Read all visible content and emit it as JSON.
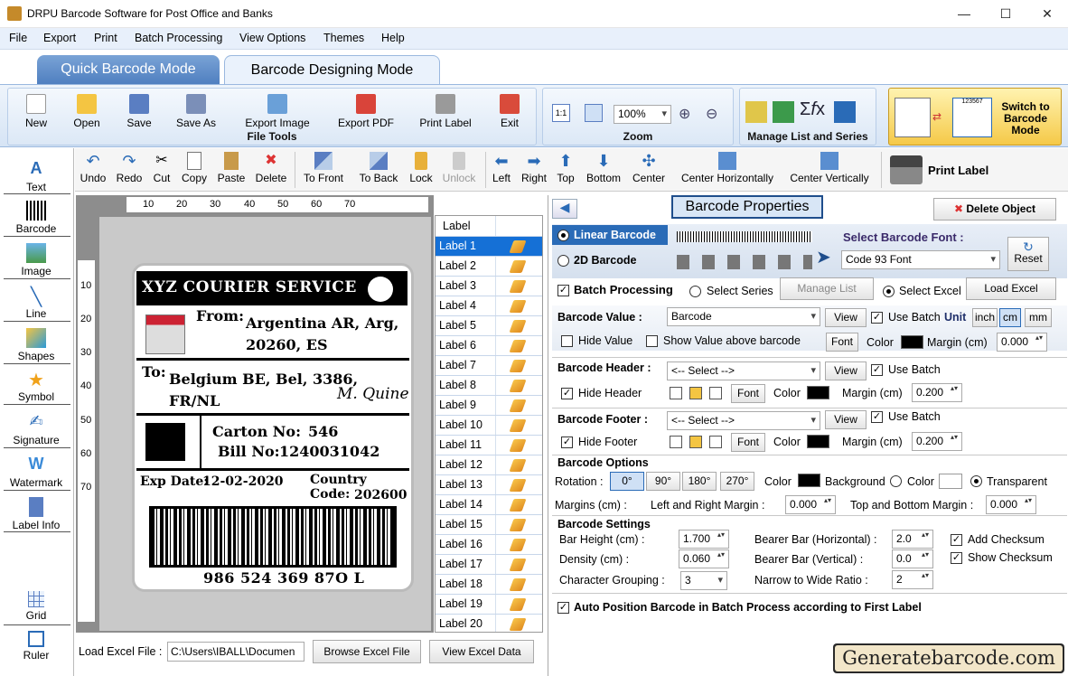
{
  "window": {
    "title": "DRPU Barcode Software for Post Office and Banks",
    "minimize": "—",
    "maximize": "☐",
    "close": "✕"
  },
  "menu": [
    "File",
    "Export",
    "Print",
    "Batch Processing",
    "View Options",
    "Themes",
    "Help"
  ],
  "mode_tabs": {
    "quick": "Quick Barcode Mode",
    "design": "Barcode Designing Mode"
  },
  "ribbon": {
    "file_tools": {
      "title": "File Tools",
      "buttons": [
        "New",
        "Open",
        "Save",
        "Save As",
        "Export Image",
        "Export PDF",
        "Print Label",
        "Exit"
      ]
    },
    "zoom": {
      "title": "Zoom",
      "value": "100%"
    },
    "manage": {
      "title": "Manage List and Series"
    },
    "switch": {
      "label": "Switch to Barcode Mode",
      "sample_code": "123567"
    }
  },
  "edit_toolbar": [
    "Undo",
    "Redo",
    "Cut",
    "Copy",
    "Paste",
    "Delete",
    "To Front",
    "To Back",
    "Lock",
    "Unlock",
    "Left",
    "Right",
    "Top",
    "Bottom",
    "Center",
    "Center Horizontally",
    "Center Vertically",
    "Print Label"
  ],
  "left_tools": [
    "Text",
    "Barcode",
    "Image",
    "Line",
    "Shapes",
    "Symbol",
    "Signature",
    "Watermark",
    "Label Info",
    "Grid",
    "Ruler"
  ],
  "ruler": {
    "h": [
      "10",
      "20",
      "30",
      "40",
      "50",
      "60",
      "70"
    ],
    "v": [
      "10",
      "20",
      "30",
      "40",
      "50",
      "60",
      "70"
    ]
  },
  "label": {
    "company": "XYZ COURIER SERVICE",
    "from_label": "From:",
    "from_addr1": "Argentina AR, Arg,",
    "from_addr2": "20260, ES",
    "to_label": "To:",
    "to_addr1": "Belgium BE, Bel, 3386,",
    "to_addr2": "FR/NL",
    "signature": "M. Quine",
    "carton_label": "Carton No:",
    "carton_value": "546",
    "bill_label": "Bill No:",
    "bill_value": "1240031042",
    "exp_label": "Exp Date:",
    "exp_value": "12-02-2020",
    "country_label": "Country Code:",
    "country_value": "202600",
    "barcode_text": "986 524 369 87O L"
  },
  "label_list": {
    "header": "Label",
    "items": [
      "Label 1",
      "Label 2",
      "Label 3",
      "Label 4",
      "Label 5",
      "Label 6",
      "Label 7",
      "Label 8",
      "Label 9",
      "Label 10",
      "Label 11",
      "Label 12",
      "Label 13",
      "Label 14",
      "Label 15",
      "Label 16",
      "Label 17",
      "Label 18",
      "Label 19",
      "Label 20"
    ]
  },
  "bottom": {
    "load_label": "Load Excel File :",
    "path": "C:\\Users\\IBALL\\Documen",
    "browse": "Browse Excel File",
    "view": "View Excel Data"
  },
  "props": {
    "title": "Barcode Properties",
    "delete": "Delete Object",
    "linear": "Linear Barcode",
    "twod": "2D Barcode",
    "select_font_label": "Select Barcode Font :",
    "font_value": "Code 93 Font",
    "reset": "Reset",
    "batch": "Batch Processing",
    "select_series": "Select Series",
    "manage_list": "Manage List",
    "select_excel": "Select Excel",
    "load_excel": "Load Excel",
    "value_label": "Barcode Value :",
    "value_select": "Barcode",
    "view": "View",
    "use_batch": "Use Batch",
    "unit": "Unit",
    "units": [
      "inch",
      "cm",
      "mm"
    ],
    "hide_value": "Hide Value",
    "show_above": "Show Value above barcode",
    "font": "Font",
    "color": "Color",
    "margin_cm": "Margin (cm)",
    "value_margin": "0.000",
    "header_label": "Barcode Header :",
    "select_placeholder": "<-- Select -->",
    "hide_header": "Hide Header",
    "header_margin": "0.200",
    "footer_label": "Barcode Footer :",
    "hide_footer": "Hide Footer",
    "footer_margin": "0.200",
    "options_title": "Barcode Options",
    "rotation": "Rotation :",
    "rotations": [
      "0°",
      "90°",
      "180°",
      "270°"
    ],
    "background": "Background",
    "transparent": "Transparent",
    "margins": "Margins (cm) :",
    "lr_margin": "Left and Right Margin :",
    "lr_value": "0.000",
    "tb_margin": "Top and Bottom Margin :",
    "tb_value": "0.000",
    "settings_title": "Barcode Settings",
    "bar_height": "Bar Height (cm) :",
    "bar_height_value": "1.700",
    "density": "Density (cm) :",
    "density_value": "0.060",
    "grouping": "Character Grouping :",
    "grouping_value": "3",
    "bearer_h": "Bearer Bar (Horizontal) :",
    "bearer_h_value": "2.0",
    "bearer_v": "Bearer Bar (Vertical) :",
    "bearer_v_value": "0.0",
    "narrow_wide": "Narrow to Wide Ratio :",
    "narrow_wide_value": "2",
    "add_checksum": "Add Checksum",
    "show_checksum": "Show Checksum",
    "auto_position": "Auto Position Barcode in Batch Process according to First Label"
  },
  "watermark": "Generatebarcode.com"
}
